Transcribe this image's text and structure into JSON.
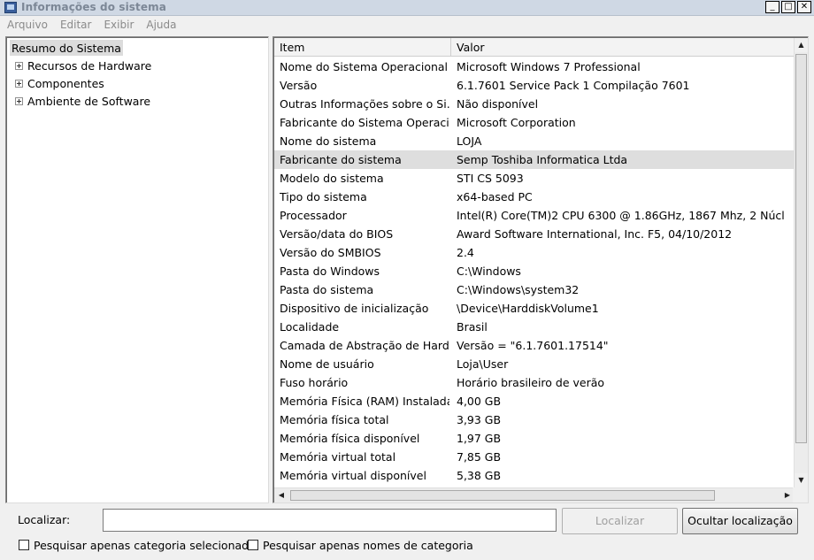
{
  "window": {
    "title": "Informações do sistema"
  },
  "menu": [
    "Arquivo",
    "Editar",
    "Exibir",
    "Ajuda"
  ],
  "tree": {
    "root": "Resumo do Sistema",
    "children": [
      "Recursos de Hardware",
      "Componentes",
      "Ambiente de Software"
    ]
  },
  "list": {
    "columns": [
      "Item",
      "Valor"
    ],
    "selected_index": 5,
    "rows": [
      {
        "item": "Nome do Sistema Operacional",
        "valor": "Microsoft Windows 7 Professional"
      },
      {
        "item": "Versão",
        "valor": "6.1.7601 Service Pack 1 Compilação 7601"
      },
      {
        "item": "Outras Informações sobre o Si...",
        "valor": "Não disponível"
      },
      {
        "item": "Fabricante do Sistema Operaci...",
        "valor": "Microsoft Corporation"
      },
      {
        "item": "Nome do sistema",
        "valor": "LOJA"
      },
      {
        "item": "Fabricante do sistema",
        "valor": "Semp Toshiba Informatica Ltda"
      },
      {
        "item": "Modelo do sistema",
        "valor": "STI CS 5093"
      },
      {
        "item": "Tipo do sistema",
        "valor": "x64-based PC"
      },
      {
        "item": "Processador",
        "valor": "Intel(R) Core(TM)2 CPU       6300  @ 1.86GHz, 1867 Mhz, 2 Núcl"
      },
      {
        "item": "Versão/data do BIOS",
        "valor": "Award Software International, Inc. F5, 04/10/2012"
      },
      {
        "item": "Versão do SMBIOS",
        "valor": "2.4"
      },
      {
        "item": "Pasta do Windows",
        "valor": "C:\\Windows"
      },
      {
        "item": "Pasta do sistema",
        "valor": "C:\\Windows\\system32"
      },
      {
        "item": "Dispositivo de inicialização",
        "valor": "\\Device\\HarddiskVolume1"
      },
      {
        "item": "Localidade",
        "valor": "Brasil"
      },
      {
        "item": "Camada de Abstração de Hard...",
        "valor": "Versão = \"6.1.7601.17514\""
      },
      {
        "item": "Nome de usuário",
        "valor": "Loja\\User"
      },
      {
        "item": "Fuso horário",
        "valor": "Horário brasileiro de verão"
      },
      {
        "item": "Memória Física (RAM) Instalada",
        "valor": "4,00 GB"
      },
      {
        "item": "Memória física total",
        "valor": "3,93 GB"
      },
      {
        "item": "Memória física disponível",
        "valor": "1,97 GB"
      },
      {
        "item": "Memória virtual total",
        "valor": "7,85 GB"
      },
      {
        "item": "Memória virtual disponível",
        "valor": "5,38 GB"
      }
    ]
  },
  "search": {
    "label": "Localizar:",
    "value": "",
    "find_button": "Localizar",
    "hide_button": "Ocultar localização",
    "checkbox_selected_category": "Pesquisar apenas categoria selecionada",
    "checkbox_category_names": "Pesquisar apenas nomes de categoria"
  }
}
